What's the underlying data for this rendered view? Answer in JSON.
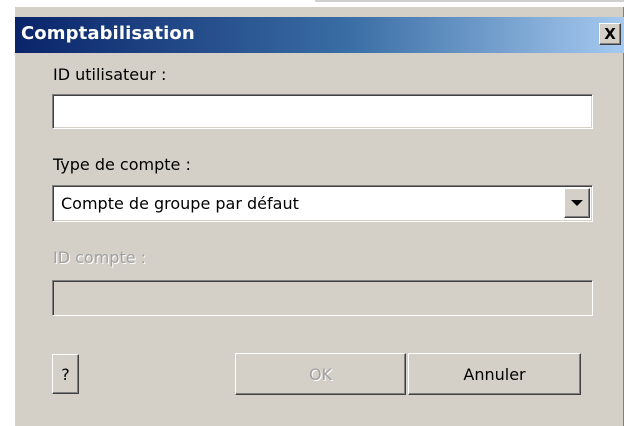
{
  "dialog": {
    "title": "Comptabilisation",
    "close_label": "X"
  },
  "fields": {
    "user_id": {
      "label": "ID utilisateur :",
      "value": ""
    },
    "account_type": {
      "label": "Type de compte :",
      "selected": "Compte de groupe par défaut"
    },
    "account_id": {
      "label": "ID compte :",
      "value": "",
      "disabled": true
    }
  },
  "buttons": {
    "help_label": "?",
    "ok_label": "OK",
    "cancel_label": "Annuler"
  },
  "colors": {
    "title_start": "#0a246a",
    "title_end": "#a6caf0",
    "face": "#d4d0c8",
    "disabled_text": "#a0a0a0"
  }
}
